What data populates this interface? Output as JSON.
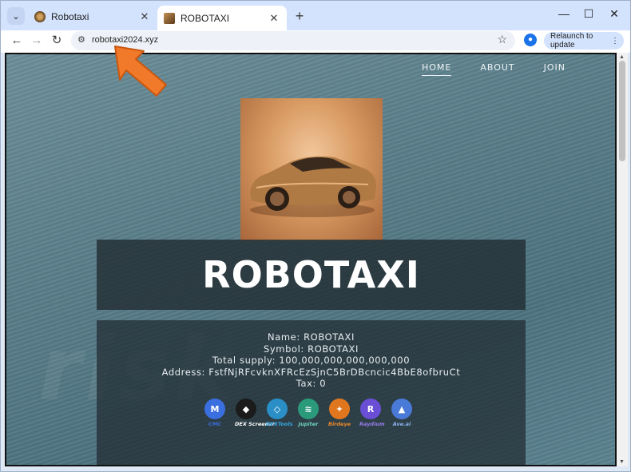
{
  "browser": {
    "tabs": [
      {
        "title": "Robotaxi",
        "active": false
      },
      {
        "title": "ROBOTAXI",
        "active": true
      }
    ],
    "new_tab_glyph": "+",
    "url": "robotaxi2024.xyz",
    "relaunch_label": "Relaunch to update",
    "window_controls": {
      "minimize": "—",
      "maximize": "☐",
      "close": "✕"
    }
  },
  "site": {
    "nav": [
      {
        "label": "HOME",
        "current": true
      },
      {
        "label": "ABOUT",
        "current": false
      },
      {
        "label": "JOIN",
        "current": false
      }
    ],
    "title": "ROBOTAXI",
    "info": {
      "name": "Name: ROBOTAXI",
      "symbol": "Symbol: ROBOTAXI",
      "supply": "Total supply: 100,000,000,000,000,000",
      "address": "Address: FstfNjRFcvknXFRcEzSjnC5BrDBcncic4BbE8ofbruCt",
      "tax": "Tax: 0"
    },
    "logos": [
      {
        "label": "CMC",
        "glyph": "M",
        "color": "#3b6fe0",
        "label_color": "#3b6fe0",
        "icon": "cmc-icon"
      },
      {
        "label": "DEX Screener",
        "glyph": "◆",
        "color": "#1b1b1b",
        "label_color": "#ffffff",
        "icon": "dexscreener-icon"
      },
      {
        "label": "DEXTools",
        "glyph": "◇",
        "color": "#2a8fc7",
        "label_color": "#35a9e6",
        "icon": "dextools-icon"
      },
      {
        "label": "Jupiter",
        "glyph": "≋",
        "color": "#2a9a7a",
        "label_color": "#6fd7c2",
        "icon": "jupiter-icon"
      },
      {
        "label": "Birdeye",
        "glyph": "✦",
        "color": "#e0771f",
        "label_color": "#f08a2a",
        "icon": "birdeye-icon"
      },
      {
        "label": "Raydium",
        "glyph": "R",
        "color": "#6a4fd6",
        "label_color": "#9b7cf0",
        "icon": "raydium-icon"
      },
      {
        "label": "Ave.ai",
        "glyph": "▲",
        "color": "#4a7ad8",
        "label_color": "#8fb6f2",
        "icon": "aveai-icon"
      }
    ]
  }
}
